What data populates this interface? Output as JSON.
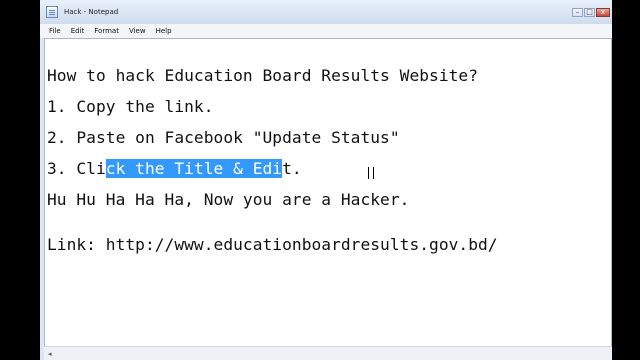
{
  "window": {
    "title": "Hack - Notepad",
    "buttons": {
      "minimize": "–",
      "maximize": "□",
      "close": "x"
    }
  },
  "menu": [
    "File",
    "Edit",
    "Format",
    "View",
    "Help"
  ],
  "document": {
    "line1": "How to hack Education Board Results Website?",
    "line2": "1. Copy the link.",
    "line3": "2. Paste on Facebook \"Update Status\"",
    "line4_pre": "3. Cli",
    "line4_sel": "ck the Title & Edi",
    "line4_post": "t.",
    "line5": "Hu Hu Ha Ha Ha, Now you are a Hacker.",
    "line6": "Link: http://www.educationboardresults.gov.bd/"
  },
  "scrollbar": {
    "left_arrow": "◂"
  },
  "colors": {
    "selection": "#3399ff",
    "titlebar": "#dbe6f4"
  }
}
